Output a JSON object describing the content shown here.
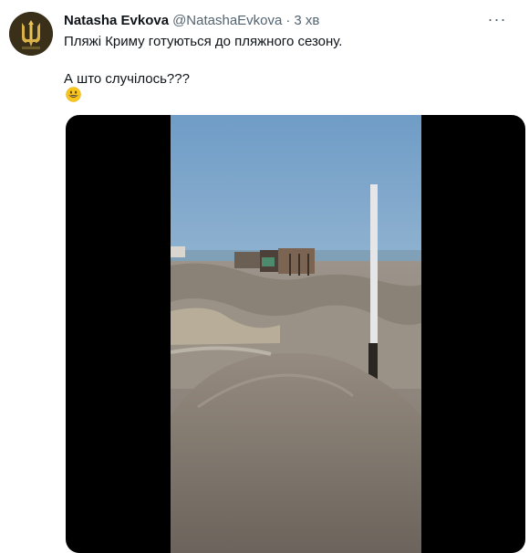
{
  "tweet": {
    "author": {
      "display_name": "Natasha Evkova",
      "handle": "@NatashaEvkova",
      "avatar_icon": "trident-avatar"
    },
    "separator": "·",
    "time": "3 хв",
    "more_icon": "more-dots-icon",
    "more_label": "···",
    "text_lines": [
      "Пляжі Криму готуються до пляжного сезону.",
      "А што случілось???"
    ],
    "emoji": "grinning-face-emoji",
    "media": {
      "type": "video",
      "scene": "sandy beach with mounds of sand under grey sky"
    }
  },
  "colors": {
    "text_primary": "#0f1419",
    "text_secondary": "#536471",
    "media_background": "#000000",
    "emoji_yellow": "#f7c51e"
  }
}
